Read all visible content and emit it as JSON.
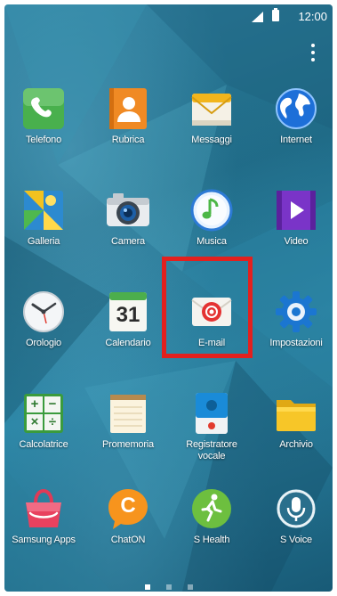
{
  "status_bar": {
    "time": "12:00"
  },
  "apps": [
    {
      "label": "Telefono",
      "icon": "phone-icon"
    },
    {
      "label": "Rubrica",
      "icon": "contacts-icon"
    },
    {
      "label": "Messaggi",
      "icon": "messages-icon"
    },
    {
      "label": "Internet",
      "icon": "internet-globe-icon"
    },
    {
      "label": "Galleria",
      "icon": "gallery-icon"
    },
    {
      "label": "Camera",
      "icon": "camera-icon"
    },
    {
      "label": "Musica",
      "icon": "music-icon"
    },
    {
      "label": "Video",
      "icon": "video-icon"
    },
    {
      "label": "Orologio",
      "icon": "clock-icon"
    },
    {
      "label": "Calendario",
      "icon": "calendar-icon",
      "badge": "31"
    },
    {
      "label": "E-mail",
      "icon": "email-icon"
    },
    {
      "label": "Impostazioni",
      "icon": "settings-gear-icon"
    },
    {
      "label": "Calcolatrice",
      "icon": "calculator-icon",
      "glyphs": [
        "+",
        "−",
        "×",
        "÷"
      ]
    },
    {
      "label": "Promemoria",
      "icon": "memo-icon"
    },
    {
      "label": "Registratore vocale",
      "icon": "voice-recorder-icon"
    },
    {
      "label": "Archivio",
      "icon": "folder-icon"
    },
    {
      "label": "Samsung Apps",
      "icon": "samsung-apps-icon"
    },
    {
      "label": "ChatON",
      "icon": "chaton-icon",
      "badge": "C"
    },
    {
      "label": "S Health",
      "icon": "s-health-icon"
    },
    {
      "label": "S Voice",
      "icon": "s-voice-icon"
    }
  ],
  "highlight": {
    "target": "E-mail",
    "color": "#e3201e"
  },
  "pager": {
    "pages": 3,
    "current": 1
  }
}
